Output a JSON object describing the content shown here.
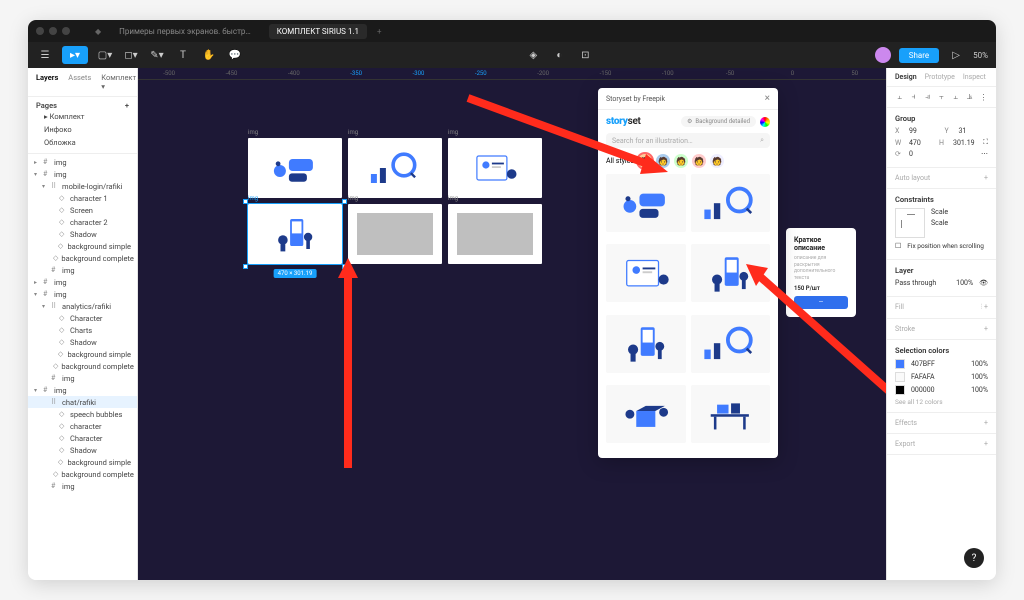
{
  "titlebar": {
    "tab1": "Примеры первых экранов. быстр…",
    "tab2": "КОМПЛЕКТ SIRIUS 1.1"
  },
  "toolbar": {
    "share": "Share",
    "zoom": "50%"
  },
  "leftPanel": {
    "tabs": {
      "layers": "Layers",
      "assets": "Assets",
      "file": "Комплект ▾"
    },
    "pages": {
      "title": "Pages",
      "items": [
        "Комплект",
        "Инфоко",
        "Обложка"
      ]
    },
    "tree": [
      {
        "d": 0,
        "t": "frame",
        "l": "img",
        "c": "▸"
      },
      {
        "d": 0,
        "t": "frame",
        "l": "img",
        "c": "▾"
      },
      {
        "d": 1,
        "t": "group",
        "l": "mobile-login/rafiki",
        "c": "▾"
      },
      {
        "d": 2,
        "t": "vec",
        "l": "character 1"
      },
      {
        "d": 2,
        "t": "vec",
        "l": "Screen"
      },
      {
        "d": 2,
        "t": "vec",
        "l": "character 2"
      },
      {
        "d": 2,
        "t": "vec",
        "l": "Shadow"
      },
      {
        "d": 2,
        "t": "vec",
        "l": "background simple"
      },
      {
        "d": 2,
        "t": "vec",
        "l": "background complete"
      },
      {
        "d": 1,
        "t": "frame",
        "l": "img"
      },
      {
        "d": 0,
        "t": "frame",
        "l": "img",
        "c": "▸"
      },
      {
        "d": 0,
        "t": "frame",
        "l": "img",
        "c": "▾"
      },
      {
        "d": 1,
        "t": "group",
        "l": "analytics/rafiki",
        "c": "▾"
      },
      {
        "d": 2,
        "t": "vec",
        "l": "Character"
      },
      {
        "d": 2,
        "t": "vec",
        "l": "Charts"
      },
      {
        "d": 2,
        "t": "vec",
        "l": "Shadow"
      },
      {
        "d": 2,
        "t": "vec",
        "l": "background simple"
      },
      {
        "d": 2,
        "t": "vec",
        "l": "background complete"
      },
      {
        "d": 1,
        "t": "frame",
        "l": "img"
      },
      {
        "d": 0,
        "t": "frame",
        "l": "img",
        "c": "▾"
      },
      {
        "d": 1,
        "t": "group",
        "l": "chat/rafiki",
        "sel": true
      },
      {
        "d": 2,
        "t": "vec",
        "l": "speech bubbles"
      },
      {
        "d": 2,
        "t": "vec",
        "l": "character"
      },
      {
        "d": 2,
        "t": "vec",
        "l": "Character"
      },
      {
        "d": 2,
        "t": "vec",
        "l": "Shadow"
      },
      {
        "d": 2,
        "t": "vec",
        "l": "background simple"
      },
      {
        "d": 2,
        "t": "vec",
        "l": "background complete"
      },
      {
        "d": 1,
        "t": "frame",
        "l": "img"
      }
    ]
  },
  "canvas": {
    "rulerMarks": [
      "-500",
      "-450",
      "-400",
      "-350",
      "-300",
      "-250",
      "-200",
      "-150",
      "-100",
      "-50",
      "0",
      "50"
    ],
    "frames": [
      {
        "label": "img",
        "type": "chat"
      },
      {
        "label": "img",
        "type": "analytics"
      },
      {
        "label": "img",
        "type": "profile"
      },
      {
        "label": "img",
        "type": "mobile",
        "selected": true,
        "dim": "470 × 301.19"
      },
      {
        "label": "img",
        "type": "placeholder"
      },
      {
        "label": "img",
        "type": "placeholder"
      }
    ],
    "descCard": {
      "title": "Краткое описание",
      "sub": "описание для раскрытия дополнительного текста",
      "price": "150 P/шт",
      "button": "—"
    }
  },
  "plugin": {
    "title": "Storyset by Freepik",
    "bgDetailed": "Background detailed",
    "searchPlaceholder": "Search for an illustration…",
    "allStyles": "All styles"
  },
  "rightPanel": {
    "tabs": {
      "design": "Design",
      "prototype": "Prototype",
      "inspect": "Inspect"
    },
    "group": {
      "title": "Group",
      "x": "99",
      "y": "31",
      "w": "470",
      "h": "301.19",
      "rot": "0"
    },
    "autoLayout": "Auto layout",
    "constraints": {
      "title": "Constraints",
      "h": "Scale",
      "v": "Scale",
      "fix": "Fix position when scrolling"
    },
    "layer": {
      "title": "Layer",
      "mode": "Pass through",
      "opacity": "100%"
    },
    "fill": "Fill",
    "stroke": "Stroke",
    "selColors": {
      "title": "Selection colors",
      "items": [
        {
          "hex": "407BFF",
          "op": "100%",
          "c": "#407BFF"
        },
        {
          "hex": "FAFAFA",
          "op": "100%",
          "c": "#FAFAFA"
        },
        {
          "hex": "000000",
          "op": "100%",
          "c": "#000000"
        }
      ],
      "more": "See all 12 colors"
    },
    "effects": "Effects",
    "export": "Export"
  }
}
